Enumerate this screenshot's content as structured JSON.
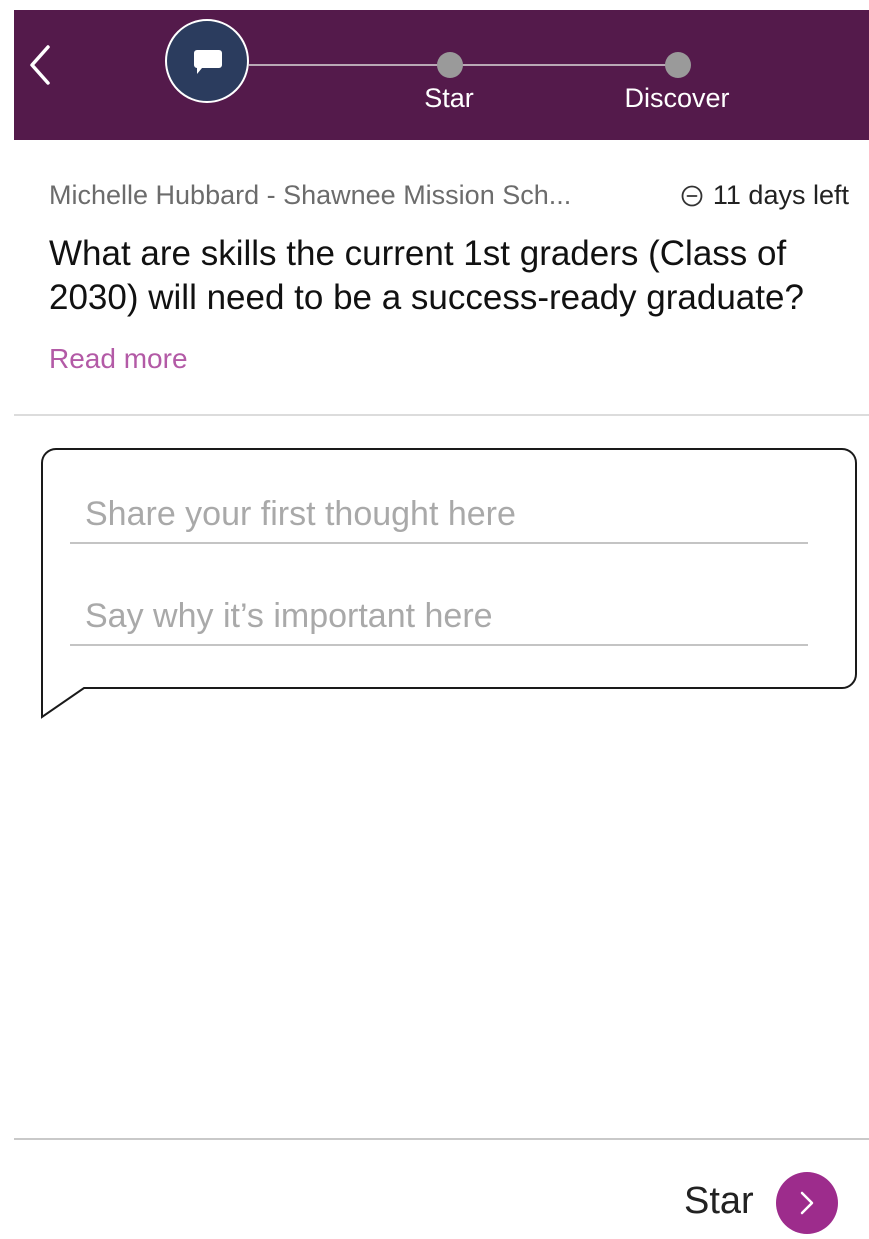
{
  "header": {
    "steps": [
      {
        "label": "",
        "state": "active",
        "icon": "chat-bubble-icon"
      },
      {
        "label": "Star",
        "state": "pending"
      },
      {
        "label": "Discover",
        "state": "pending"
      }
    ],
    "colors": {
      "background": "#541a4b",
      "active_step": "#2b3c5e",
      "pending_step": "#9a9a9a"
    }
  },
  "meta": {
    "author": "Michelle Hubbard - Shawnee Mission Sch...",
    "time_left": "11 days left"
  },
  "question": {
    "text": "What are skills the current 1st graders (Class of 2030) will need to be a success-ready graduate?",
    "read_more": "Read more"
  },
  "form": {
    "thought_placeholder": "Share your first thought here",
    "thought_value": "",
    "reason_placeholder": "Say why it’s important here",
    "reason_value": ""
  },
  "footer": {
    "next_label": "Star",
    "next_button_color": "#9d2c8c"
  }
}
